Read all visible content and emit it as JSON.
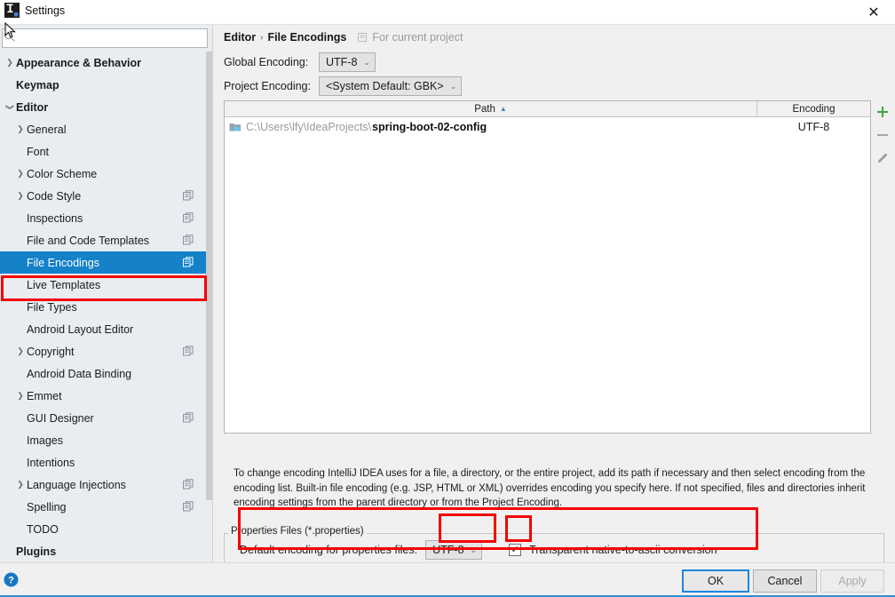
{
  "window": {
    "title": "Settings",
    "app_icon": "intellij-idea-icon",
    "close_label": "✕"
  },
  "sidebar": {
    "search": {
      "placeholder": "",
      "value": "",
      "icon": "search-icon"
    },
    "items": [
      {
        "label": "Appearance & Behavior",
        "level": 0,
        "arrow": "collapsed",
        "badge": false
      },
      {
        "label": "Keymap",
        "level": 0,
        "arrow": "none",
        "badge": false
      },
      {
        "label": "Editor",
        "level": 0,
        "arrow": "expanded",
        "badge": false
      },
      {
        "label": "General",
        "level": 1,
        "arrow": "collapsed",
        "badge": false
      },
      {
        "label": "Font",
        "level": 1,
        "arrow": "none",
        "badge": false
      },
      {
        "label": "Color Scheme",
        "level": 1,
        "arrow": "collapsed",
        "badge": false
      },
      {
        "label": "Code Style",
        "level": 1,
        "arrow": "collapsed",
        "badge": true
      },
      {
        "label": "Inspections",
        "level": 1,
        "arrow": "none",
        "badge": true
      },
      {
        "label": "File and Code Templates",
        "level": 1,
        "arrow": "none",
        "badge": true
      },
      {
        "label": "File Encodings",
        "level": 1,
        "arrow": "none",
        "badge": true,
        "selected": true
      },
      {
        "label": "Live Templates",
        "level": 1,
        "arrow": "none",
        "badge": false
      },
      {
        "label": "File Types",
        "level": 1,
        "arrow": "none",
        "badge": false
      },
      {
        "label": "Android Layout Editor",
        "level": 1,
        "arrow": "none",
        "badge": false
      },
      {
        "label": "Copyright",
        "level": 1,
        "arrow": "collapsed",
        "badge": true
      },
      {
        "label": "Android Data Binding",
        "level": 1,
        "arrow": "none",
        "badge": false
      },
      {
        "label": "Emmet",
        "level": 1,
        "arrow": "collapsed",
        "badge": false
      },
      {
        "label": "GUI Designer",
        "level": 1,
        "arrow": "none",
        "badge": true
      },
      {
        "label": "Images",
        "level": 1,
        "arrow": "none",
        "badge": false
      },
      {
        "label": "Intentions",
        "level": 1,
        "arrow": "none",
        "badge": false
      },
      {
        "label": "Language Injections",
        "level": 1,
        "arrow": "collapsed",
        "badge": true
      },
      {
        "label": "Spelling",
        "level": 1,
        "arrow": "none",
        "badge": true
      },
      {
        "label": "TODO",
        "level": 1,
        "arrow": "none",
        "badge": false
      },
      {
        "label": "Plugins",
        "level": 0,
        "arrow": "none",
        "badge": false
      }
    ]
  },
  "main": {
    "breadcrumb": {
      "parent": "Editor",
      "separator": "›",
      "current": "File Encodings",
      "scope_icon": "project-scope-icon",
      "scope_text": "For current project"
    },
    "global_encoding": {
      "label": "Global Encoding:",
      "value": "UTF-8"
    },
    "project_encoding": {
      "label": "Project Encoding:",
      "value": "<System Default: GBK>"
    },
    "table": {
      "columns": [
        "Path",
        "Encoding"
      ],
      "sort_column": "Path",
      "sort_direction": "asc",
      "rows": [
        {
          "path_prefix": "C:\\Users\\lfy\\IdeaProjects\\",
          "path_name": "spring-boot-02-config",
          "encoding": "UTF-8",
          "icon": "folder-icon"
        }
      ]
    },
    "toolbar": {
      "add": "+",
      "remove": "−",
      "edit": "pencil-icon"
    },
    "description": "To change encoding IntelliJ IDEA uses for a file, a directory, or the entire project, add its path if necessary and then select encoding from the encoding list. Built-in file encoding (e.g. JSP, HTML or XML) overrides encoding you specify here. If not specified, files and directories inherit encoding settings from the parent directory or from the Project Encoding.",
    "properties_group": {
      "title": "Properties Files (*.properties)",
      "default_encoding_label": "Default encoding for properties files:",
      "default_encoding_value": "UTF-8",
      "transparent_conversion_label": "Transparent native-to-ascii conversion",
      "transparent_conversion_checked": true,
      "checkmark": "✓"
    }
  },
  "footer": {
    "help_icon": "help-icon",
    "ok": "OK",
    "cancel": "Cancel",
    "apply": "Apply"
  },
  "colors": {
    "selection_blue": "#1581c9",
    "highlight_red": "#f50000",
    "accent_blue": "#2d8fd5",
    "sidebar_bg": "#e9edf1",
    "panel_bg": "#f0f0f0"
  }
}
